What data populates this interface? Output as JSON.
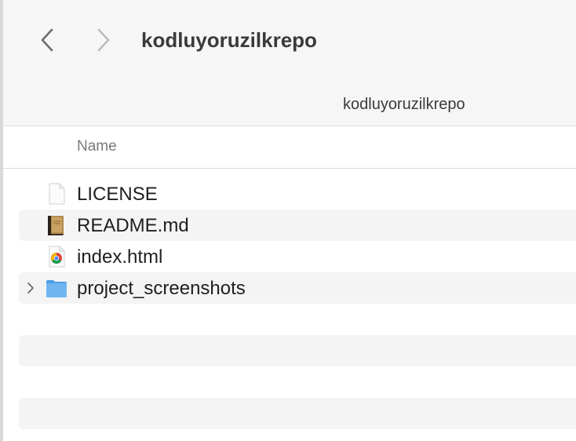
{
  "toolbar": {
    "title": "kodluyoruzilkrepo",
    "back_icon": "chevron-left-icon",
    "forward_icon": "chevron-right-icon"
  },
  "pathbar": {
    "folder": "kodluyoruzilkrepo"
  },
  "columns": {
    "name": "Name"
  },
  "files": [
    {
      "name": "LICENSE",
      "icon": "document-icon",
      "expandable": false
    },
    {
      "name": "README.md",
      "icon": "markdown-book-icon",
      "expandable": false
    },
    {
      "name": "index.html",
      "icon": "chrome-html-icon",
      "expandable": false
    },
    {
      "name": "project_screenshots",
      "icon": "folder-icon",
      "expandable": true
    }
  ],
  "colors": {
    "toolbar_bg": "#f6f6f6",
    "row_alt_bg": "#f4f4f4",
    "folder_blue": "#5aa9ec"
  }
}
